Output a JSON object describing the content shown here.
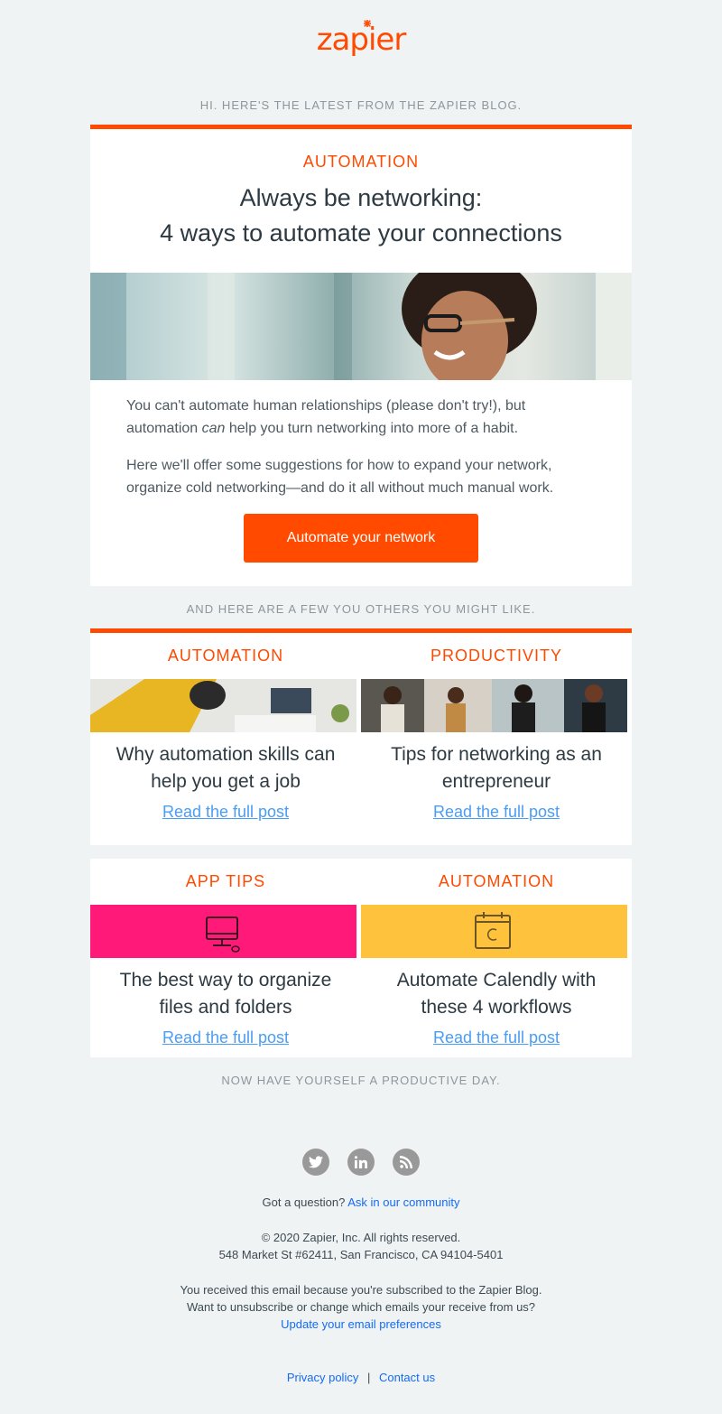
{
  "brand": {
    "logo_text": "zapier",
    "accent": "#ff4a00"
  },
  "intro": "HI. HERE'S THE LATEST FROM THE ZAPIER BLOG.",
  "hero": {
    "category": "AUTOMATION",
    "title_line1": "Always be networking:",
    "title_line2": "4 ways to automate your connections",
    "para1_a": "You can't automate human relationships (please don't try!), but automation ",
    "para1_em": "can",
    "para1_b": " help you turn networking into more of a habit.",
    "para2": "Here we'll offer some suggestions for how to expand your network, organize cold networking—and do it all without much manual work.",
    "cta": "Automate your network"
  },
  "others_heading": "AND HERE ARE A FEW YOU OTHERS YOU MIGHT LIKE.",
  "posts": [
    {
      "category": "AUTOMATION",
      "title": "Why automation skills can help you get a job",
      "link": "Read the full post"
    },
    {
      "category": "PRODUCTIVITY",
      "title": "Tips for networking as an entrepreneur",
      "link": "Read the full post"
    },
    {
      "category": "APP TIPS",
      "title": "The best way to organize files and folders",
      "link": "Read the full post",
      "bg": "#ff1a7a"
    },
    {
      "category": "AUTOMATION",
      "title": "Automate Calendly with these 4 workflows",
      "link": "Read the full post",
      "bg": "#ffc23d"
    }
  ],
  "signoff": "NOW HAVE YOURSELF A PRODUCTIVE DAY.",
  "social": {
    "twitter": "twitter-icon",
    "linkedin": "linkedin-icon",
    "rss": "rss-icon"
  },
  "footer": {
    "question": "Got a question?",
    "community_link": "Ask in our community",
    "copyright": "© 2020 Zapier, Inc. All rights reserved.",
    "address": "548 Market St #62411, San Francisco, CA 94104-5401",
    "reason1": "You received this email because you're subscribed to the Zapier Blog.",
    "reason2": "Want to unsubscribe or change which emails your receive from us?",
    "prefs_link": "Update your email preferences",
    "privacy": "Privacy policy",
    "separator": "|",
    "contact": "Contact us"
  }
}
